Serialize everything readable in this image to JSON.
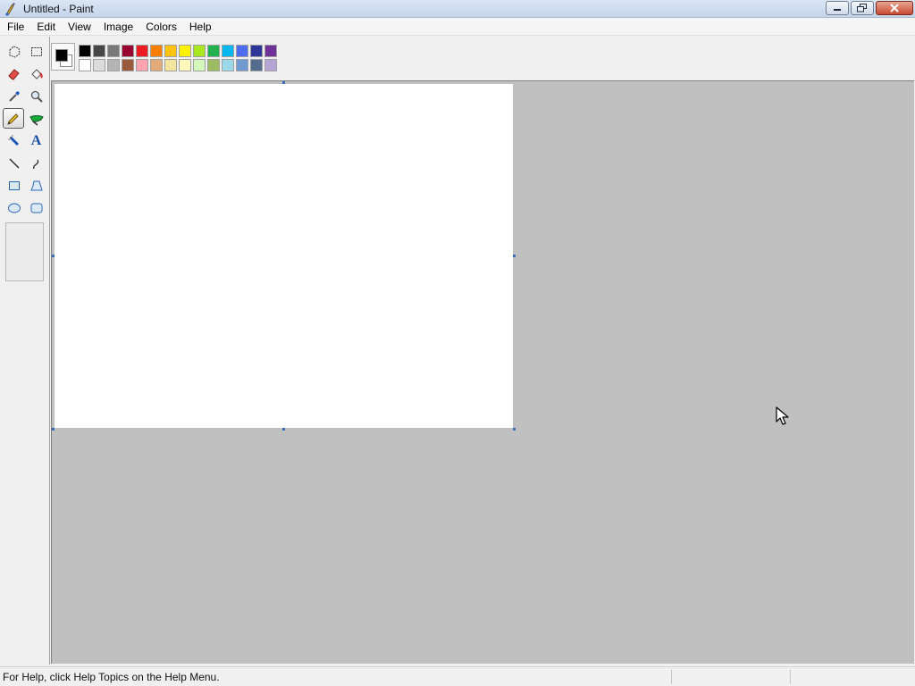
{
  "window": {
    "title": "Untitled - Paint"
  },
  "menu": [
    {
      "label": "File"
    },
    {
      "label": "Edit"
    },
    {
      "label": "View"
    },
    {
      "label": "Image"
    },
    {
      "label": "Colors"
    },
    {
      "label": "Help"
    }
  ],
  "tools": [
    {
      "name": "free-form-select-icon"
    },
    {
      "name": "select-icon"
    },
    {
      "name": "eraser-icon"
    },
    {
      "name": "fill-with-color-icon"
    },
    {
      "name": "pick-color-icon"
    },
    {
      "name": "magnifier-icon"
    },
    {
      "name": "pencil-icon",
      "selected": true
    },
    {
      "name": "brush-icon"
    },
    {
      "name": "airbrush-icon"
    },
    {
      "name": "text-icon",
      "glyph": "A"
    },
    {
      "name": "line-icon"
    },
    {
      "name": "curve-icon"
    },
    {
      "name": "rectangle-icon"
    },
    {
      "name": "polygon-icon"
    },
    {
      "name": "ellipse-icon"
    },
    {
      "name": "rounded-rectangle-icon"
    }
  ],
  "colors": {
    "foreground": "#000000",
    "background": "#ffffff",
    "palette_top": [
      "#000000",
      "#464646",
      "#787878",
      "#990030",
      "#ed1c24",
      "#ff7e00",
      "#ffc20e",
      "#fff200",
      "#a8e61d",
      "#22b14c",
      "#00b7ef",
      "#4d6df3",
      "#2f3699",
      "#6f3198"
    ],
    "palette_bottom": [
      "#ffffff",
      "#dcdcdc",
      "#b4b4b4",
      "#9c5a3c",
      "#ffa3b1",
      "#e5aa7a",
      "#f5e49c",
      "#fff9bd",
      "#d3f9bc",
      "#9dbb61",
      "#99d9ea",
      "#709ad1",
      "#546d8e",
      "#b5a5d5"
    ]
  },
  "status": {
    "text": "For Help, click Help Topics on the Help Menu."
  }
}
